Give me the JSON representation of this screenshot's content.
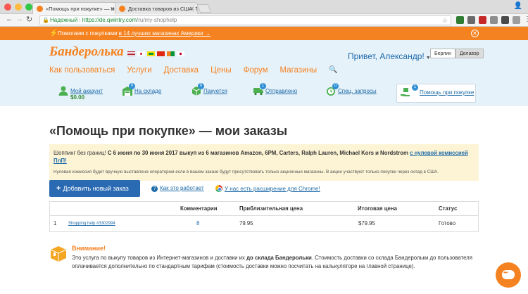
{
  "browser": {
    "tabs": [
      {
        "title": "«Помощь при покупке» — м",
        "active": true
      },
      {
        "title": "Доставка товаров из США. Т",
        "active": false
      }
    ],
    "url_secure_label": "Надежный",
    "url_host": "https://de.qwintry.com",
    "url_path": "/ru/my-shophelp",
    "colors": {
      "close": "#fc5753",
      "minimize": "#fdbc40",
      "maximize": "#33c748"
    }
  },
  "promo": {
    "text": "Помогаем с покупками",
    "link": "в 14 лучших магазинах Америки →",
    "bg": "#f58220"
  },
  "header": {
    "logo": "Бандеролька",
    "greeting": "Привет, Александр!",
    "cities": [
      "Берлин",
      "Делавэр"
    ],
    "active_city": "Делавэр",
    "nav": [
      "Как пользоваться",
      "Услуги",
      "Доставка",
      "Цены",
      "Форум",
      "Магазины"
    ],
    "subnav": [
      {
        "label": "Мой аккаунт",
        "balance": "$0.00"
      },
      {
        "label": "На складе",
        "badge": "0"
      },
      {
        "label": "Пакуется",
        "badge": "0"
      },
      {
        "label": "Отправлено",
        "badge": "1"
      },
      {
        "label": "Спец. запросы",
        "badge": "0"
      },
      {
        "label": "Помощь при покупке",
        "badge": "1"
      }
    ]
  },
  "page": {
    "title": "«Помощь при покупке» — мои заказы",
    "notice": {
      "intro": "Шоппинг без границ!",
      "bold": "С 6 июня по 30 июня 2017 выкуп из 6 магазинов Amazon, 6PM, Carters, Ralph Lauren, Michael Kors и Nordstrom",
      "link": "с нулевой комиссией ПлП!",
      "note": "Нулевая комиссия будет вручную выставлена оператором если в вашем заказе будут присутствовать только акционные магазины. В акции участвуют только покупки через склад в США."
    },
    "add_button": "Добавить новый заказ",
    "how_link": "Как это работает",
    "chrome_link": "У нас есть расширение для Chrome!",
    "table": {
      "headers": {
        "comments": "Комментарии",
        "approx_price": "Приблизительная цена",
        "total": "Итоговая цена",
        "status": "Статус"
      },
      "rows": [
        {
          "n": "1",
          "name": "Shopping help #3302994",
          "comments": "8",
          "approx": "79.95",
          "total": "$79.95",
          "status": "Готово"
        }
      ]
    },
    "warning": {
      "title": "Внимание!",
      "p1": "Это услуга по выкупу товаров из Интернет-магазинов и доставки их",
      "bold": "до склада Бандерольки",
      "p2": ". Стоимость доставки со склада Бандерольки до пользователя оплачивается дополнительно по стандартным тарифам (стоимость доставки можно посчитать на калькуляторе на главной странице)."
    }
  }
}
